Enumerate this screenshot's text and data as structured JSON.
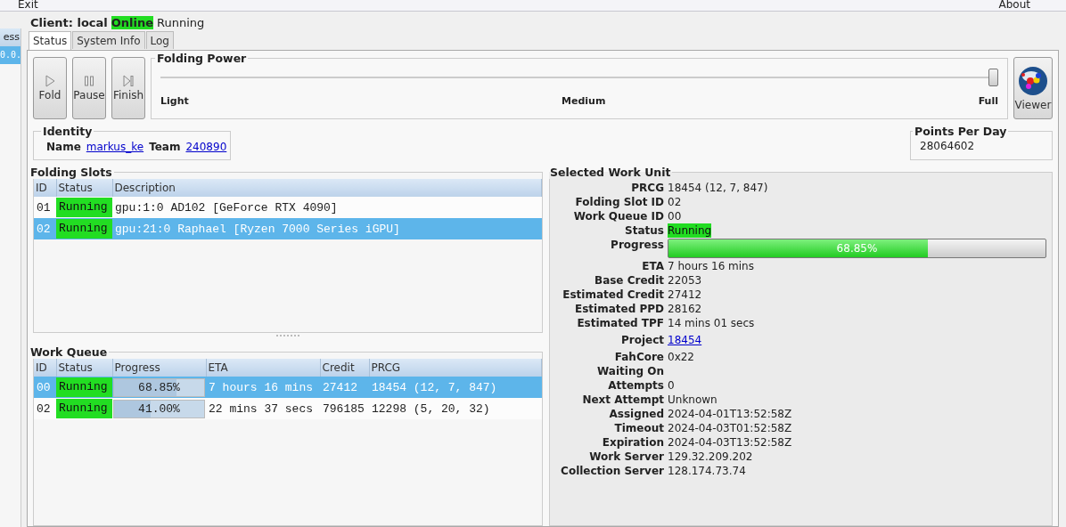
{
  "menu": [
    "Exit",
    "About"
  ],
  "sidebar": {
    "header": "ess",
    "rows": [
      {
        "text": "0.0.",
        "selected": true
      }
    ]
  },
  "client": {
    "title": "Client: local",
    "connection": "Online",
    "state": "Running"
  },
  "tabs": [
    {
      "label": "Status",
      "selected": true
    },
    {
      "label": "System Info",
      "selected": false
    },
    {
      "label": "Log",
      "selected": false
    }
  ],
  "controls": [
    {
      "label": "Fold",
      "kind": "play"
    },
    {
      "label": "Pause",
      "kind": "pause"
    },
    {
      "label": "Finish",
      "kind": "finish"
    }
  ],
  "folding_power": {
    "title": "Folding Power",
    "level": 1.0,
    "ticks": [
      "Light",
      "Medium",
      "Full"
    ]
  },
  "viewer_button": "Viewer",
  "identity": {
    "title": "Identity",
    "name_label": "Name",
    "name": "markus_ke",
    "team_label": "Team",
    "team": "240890"
  },
  "points_per_day": {
    "title": "Points Per Day",
    "value": "28064602"
  },
  "folding_slots": {
    "title": "Folding Slots",
    "columns": [
      "ID",
      "Status",
      "Description"
    ],
    "rows": [
      {
        "id": "01",
        "status": "Running",
        "description": "gpu:1:0 AD102 [GeForce RTX 4090]",
        "selected": false
      },
      {
        "id": "02",
        "status": "Running",
        "description": "gpu:21:0 Raphael [Ryzen 7000 Series iGPU]",
        "selected": true
      }
    ]
  },
  "work_queue": {
    "title": "Work Queue",
    "columns": [
      "ID",
      "Status",
      "Progress",
      "ETA",
      "Credit",
      "PRCG"
    ],
    "rows": [
      {
        "id": "00",
        "status": "Running",
        "progress": "68.85%",
        "level": 0.6885,
        "eta": "7 hours 16 mins",
        "credit": "27412",
        "prcg": "18454 (12, 7, 847)",
        "selected": true
      },
      {
        "id": "02",
        "status": "Running",
        "progress": "41.00%",
        "level": 0.41,
        "eta": "22 mins 37 secs",
        "credit": "796185",
        "prcg": "12298 (5, 20, 32)",
        "selected": false
      }
    ]
  },
  "selected_work_unit": {
    "title": "Selected Work Unit",
    "fields": [
      {
        "label": "PRCG",
        "value": "18454 (12, 7, 847)",
        "kind": "text"
      },
      {
        "label": "Folding Slot ID",
        "value": "02",
        "kind": "text"
      },
      {
        "label": "Work Queue ID",
        "value": "00",
        "kind": "text"
      },
      {
        "label": "Status",
        "value": "Running",
        "kind": "status"
      },
      {
        "label": "Progress",
        "value": "68.85%",
        "kind": "progress",
        "level": 0.6885
      },
      {
        "label": "ETA",
        "value": "7 hours 16 mins",
        "kind": "text"
      },
      {
        "label": "Base Credit",
        "value": "22053",
        "kind": "text"
      },
      {
        "label": "Estimated Credit",
        "value": "27412",
        "kind": "text"
      },
      {
        "label": "Estimated PPD",
        "value": "28162",
        "kind": "text"
      },
      {
        "label": "Estimated TPF",
        "value": "14 mins 01 secs",
        "kind": "text"
      },
      {
        "label": "Project",
        "value": "18454",
        "kind": "link"
      },
      {
        "label": "FahCore",
        "value": "0x22",
        "kind": "text"
      },
      {
        "label": "Waiting On",
        "kind": "text"
      },
      {
        "label": "Attempts",
        "value": "0",
        "kind": "text"
      },
      {
        "label": "Next Attempt",
        "value": "Unknown",
        "kind": "text"
      },
      {
        "label": "Assigned",
        "value": "2024-04-01T13:52:58Z",
        "kind": "text"
      },
      {
        "label": "Timeout",
        "value": "2024-04-03T01:52:58Z",
        "kind": "text"
      },
      {
        "label": "Expiration",
        "value": "2024-04-03T13:52:58Z",
        "kind": "text"
      },
      {
        "label": "Work Server",
        "value": "129.32.209.202",
        "kind": "text"
      },
      {
        "label": "Collection Server",
        "value": "128.174.73.74",
        "kind": "text"
      }
    ]
  }
}
